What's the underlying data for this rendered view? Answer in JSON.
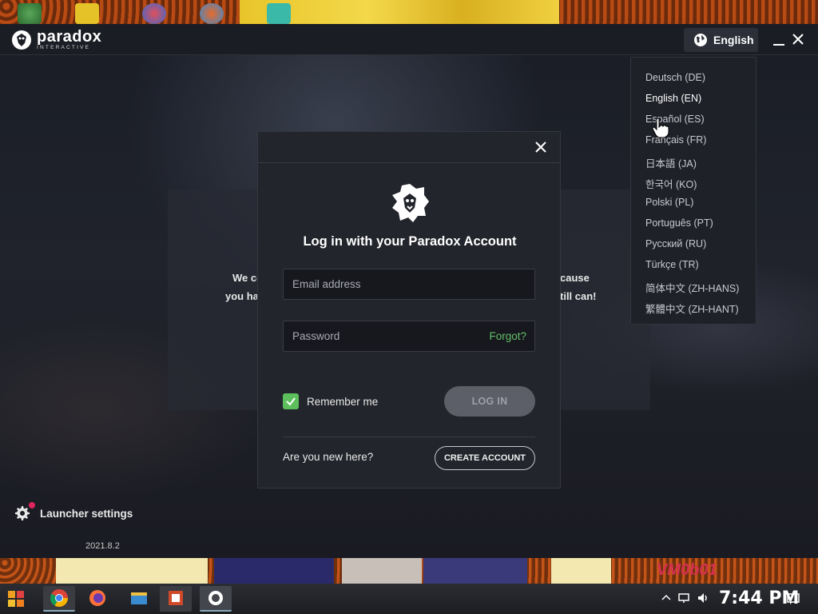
{
  "app": {
    "brand_big": "paradox",
    "brand_small": "INTERACTIVE",
    "language_button": "English"
  },
  "background": {
    "text_line1_left": "We co",
    "text_line1_right": "cause",
    "text_line2_left": "you ha",
    "text_line2_right": "till can!"
  },
  "modal": {
    "title": "Log in with your Paradox Account",
    "email_placeholder": "Email address",
    "password_placeholder": "Password",
    "forgot_link": "Forgot?",
    "remember_label": "Remember me",
    "remember_checked": true,
    "login_button": "LOG IN",
    "new_here": "Are you new here?",
    "create_account": "CREATE ACCOUNT"
  },
  "language_menu": {
    "items": [
      {
        "label": "Deutsch (DE)"
      },
      {
        "label": "English (EN)",
        "selected": true
      },
      {
        "label": "Español (ES)"
      },
      {
        "label": "Français (FR)"
      },
      {
        "label": "日本語 (JA)"
      },
      {
        "label": "한국어 (KO)"
      },
      {
        "label": "Polski (PL)"
      },
      {
        "label": "Português (PT)"
      },
      {
        "label": "Русский (RU)"
      },
      {
        "label": "Türkçe (TR)"
      },
      {
        "label": "简体中文 (ZH-HANS)"
      },
      {
        "label": "繁體中文 (ZH-HANT)"
      }
    ]
  },
  "footer": {
    "settings_label": "Launcher settings",
    "version": "2021.8.2"
  },
  "desktop": {
    "strip_text": "VM0b01"
  },
  "taskbar": {
    "clock": "7:44 PM"
  },
  "colors": {
    "accent_green": "#5cbf5c",
    "notification_dot": "#e0245e"
  }
}
